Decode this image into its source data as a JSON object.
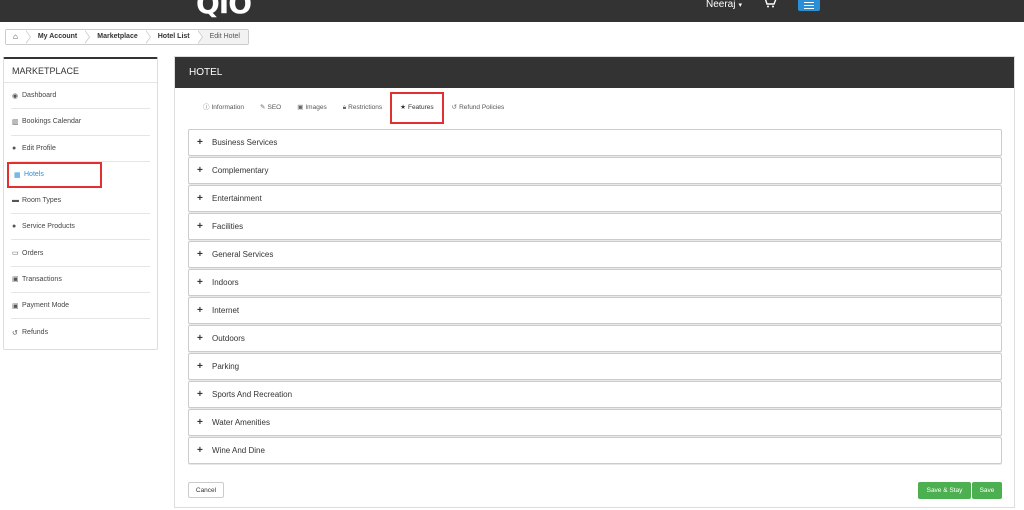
{
  "header": {
    "logo": "QIO",
    "user_name": "Neeraj",
    "caret": "▾",
    "cart_icon": "cart-icon",
    "menu_icon": "hamburger-icon"
  },
  "breadcrumb": {
    "home_icon": "home-icon",
    "items": [
      "My Account",
      "Marketplace",
      "Hotel List",
      "Edit Hotel"
    ]
  },
  "sidebar": {
    "title": "MARKETPLACE",
    "items": [
      {
        "label": "Dashboard",
        "icon": "dashboard-icon"
      },
      {
        "label": "Bookings Calendar",
        "icon": "bar-chart-icon"
      },
      {
        "label": "Edit Profile",
        "icon": "user-icon"
      },
      {
        "label": "Hotels",
        "icon": "building-icon"
      },
      {
        "label": "Room Types",
        "icon": "bed-icon"
      },
      {
        "label": "Service Products",
        "icon": "users-icon"
      },
      {
        "label": "Orders",
        "icon": "credit-card-icon"
      },
      {
        "label": "Transactions",
        "icon": "money-icon"
      },
      {
        "label": "Payment Mode",
        "icon": "money-icon"
      },
      {
        "label": "Refunds",
        "icon": "undo-icon"
      }
    ],
    "active_item": "Hotels"
  },
  "panel": {
    "title": "HOTEL",
    "tabs": [
      {
        "label": "Information",
        "icon": "info-icon"
      },
      {
        "label": "SEO",
        "icon": "pencil-icon"
      },
      {
        "label": "Images",
        "icon": "image-icon"
      },
      {
        "label": "Restrictions",
        "icon": "lock-icon"
      },
      {
        "label": "Features",
        "icon": "star-icon"
      },
      {
        "label": "Refund Policies",
        "icon": "undo-icon"
      }
    ],
    "active_tab": "Features",
    "feature_groups": [
      "Business Services",
      "Complementary",
      "Entertainment",
      "Facilities",
      "General Services",
      "Indoors",
      "Internet",
      "Outdoors",
      "Parking",
      "Sports And Recreation",
      "Water Amenities",
      "Wine And Dine"
    ],
    "buttons": {
      "cancel": "Cancel",
      "save_and_stay": "Save & Stay",
      "save": "Save"
    }
  },
  "colors": {
    "topbar": "#333333",
    "accent": "#2b8fd6",
    "highlight": "#e03030",
    "button_green": "#4caf50"
  }
}
